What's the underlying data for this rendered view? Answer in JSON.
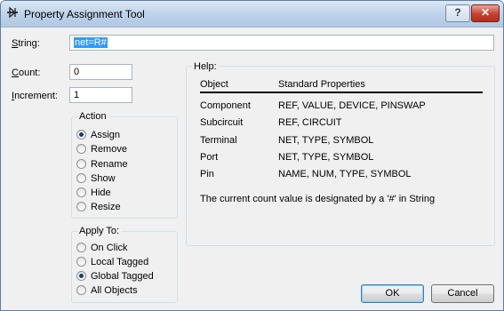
{
  "window": {
    "title": "Property Assignment Tool",
    "help_button": "?",
    "close_button": "✕"
  },
  "fields": {
    "string": {
      "label": "String:",
      "value": "net=R#"
    },
    "count": {
      "label": "Count:",
      "value": "0"
    },
    "increment": {
      "label": "Increment:",
      "value": "1"
    }
  },
  "action": {
    "title": "Action",
    "options": [
      {
        "label": "Assign",
        "checked": true
      },
      {
        "label": "Remove",
        "checked": false
      },
      {
        "label": "Rename",
        "checked": false
      },
      {
        "label": "Show",
        "checked": false
      },
      {
        "label": "Hide",
        "checked": false
      },
      {
        "label": "Resize",
        "checked": false
      }
    ]
  },
  "apply_to": {
    "title": "Apply To:",
    "options": [
      {
        "label": "On Click",
        "checked": false
      },
      {
        "label": "Local Tagged",
        "checked": false
      },
      {
        "label": "Global Tagged",
        "checked": true
      },
      {
        "label": "All Objects",
        "checked": false
      }
    ]
  },
  "help": {
    "title": "Help:",
    "headers": [
      "Object",
      "Standard Properties"
    ],
    "rows": [
      [
        "Component",
        "REF, VALUE, DEVICE, PINSWAP"
      ],
      [
        "Subcircuit",
        "REF, CIRCUIT"
      ],
      [
        "Terminal",
        "NET, TYPE, SYMBOL"
      ],
      [
        "Port",
        "NET, TYPE, SYMBOL"
      ],
      [
        "Pin",
        "NAME, NUM, TYPE, SYMBOL"
      ]
    ],
    "note": "The current count value is designated by a '#' in String"
  },
  "buttons": {
    "ok": "OK",
    "cancel": "Cancel"
  }
}
